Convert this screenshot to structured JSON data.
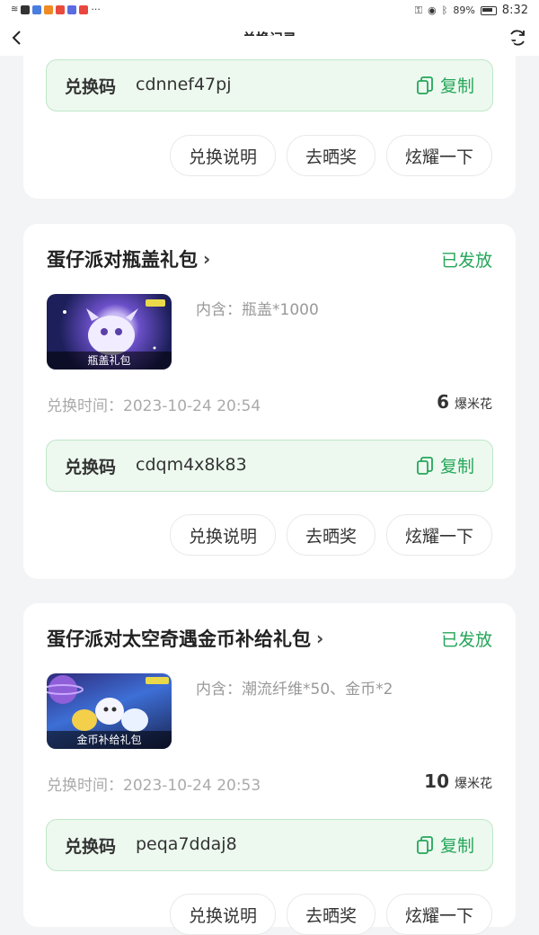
{
  "status_bar": {
    "battery": "89%",
    "time": "8:32"
  },
  "header": {
    "title": "兑换记录"
  },
  "cards": [
    {
      "code_label": "兑换码",
      "code": "cdnnef47pj",
      "copy_label": "复制",
      "actions": [
        "兑换说明",
        "去晒奖",
        "炫耀一下"
      ]
    },
    {
      "title": "蛋仔派对瓶盖礼包",
      "status": "已发放",
      "thumb_caption": "瓶盖礼包",
      "contents": "内含：瓶盖*1000",
      "time": "兑换时间：2023-10-24 20:54",
      "price_value": "6",
      "price_unit": "爆米花",
      "code_label": "兑换码",
      "code": "cdqm4x8k83",
      "copy_label": "复制",
      "actions": [
        "兑换说明",
        "去晒奖",
        "炫耀一下"
      ]
    },
    {
      "title": "蛋仔派对太空奇遇金币补给礼包",
      "status": "已发放",
      "thumb_caption": "金币补给礼包",
      "contents": "内含：潮流纤维*50、金币*2",
      "time": "兑换时间：2023-10-24 20:53",
      "price_value": "10",
      "price_unit": "爆米花",
      "code_label": "兑换码",
      "code": "peqa7ddaj8",
      "copy_label": "复制",
      "actions": [
        "兑换说明",
        "去晒奖",
        "炫耀一下"
      ]
    }
  ],
  "colors": {
    "accent": "#25a65a",
    "code_bg": "#edf9ef",
    "page_bg": "#f3f4f6"
  },
  "icons": [
    "back-arrow-icon",
    "refresh-icon",
    "copy-icon",
    "chevron-right-icon"
  ]
}
